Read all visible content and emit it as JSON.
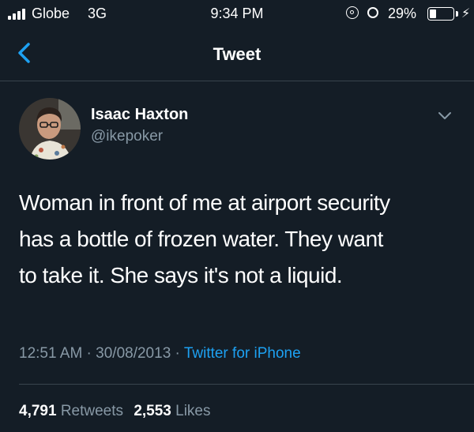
{
  "status_bar": {
    "carrier": "Globe",
    "network": "3G",
    "time": "9:34 PM",
    "battery_percent": "29%",
    "battery_level": 0.29,
    "icons": [
      "signal-icon",
      "orientation-lock-icon",
      "alarm-icon",
      "battery-icon",
      "charging-icon"
    ]
  },
  "nav": {
    "title": "Tweet",
    "back_icon": "chevron-left-icon"
  },
  "tweet": {
    "author": {
      "display_name": "Isaac Haxton",
      "handle": "@ikepoker"
    },
    "text_lines": [
      "Woman in front of me at airport security",
      "has a bottle of frozen water. They want",
      "to take it. She says it's not a liquid."
    ],
    "timestamp": "12:51 AM · 30/08/2013 ·",
    "source": "Twitter for iPhone",
    "stats": {
      "retweets_count": "4,791",
      "retweets_label": "Retweets",
      "likes_count": "2,553",
      "likes_label": "Likes"
    }
  },
  "colors": {
    "background": "#141d26",
    "secondary_text": "#8899a6",
    "accent": "#1da1f2",
    "divider": "#38444d"
  }
}
